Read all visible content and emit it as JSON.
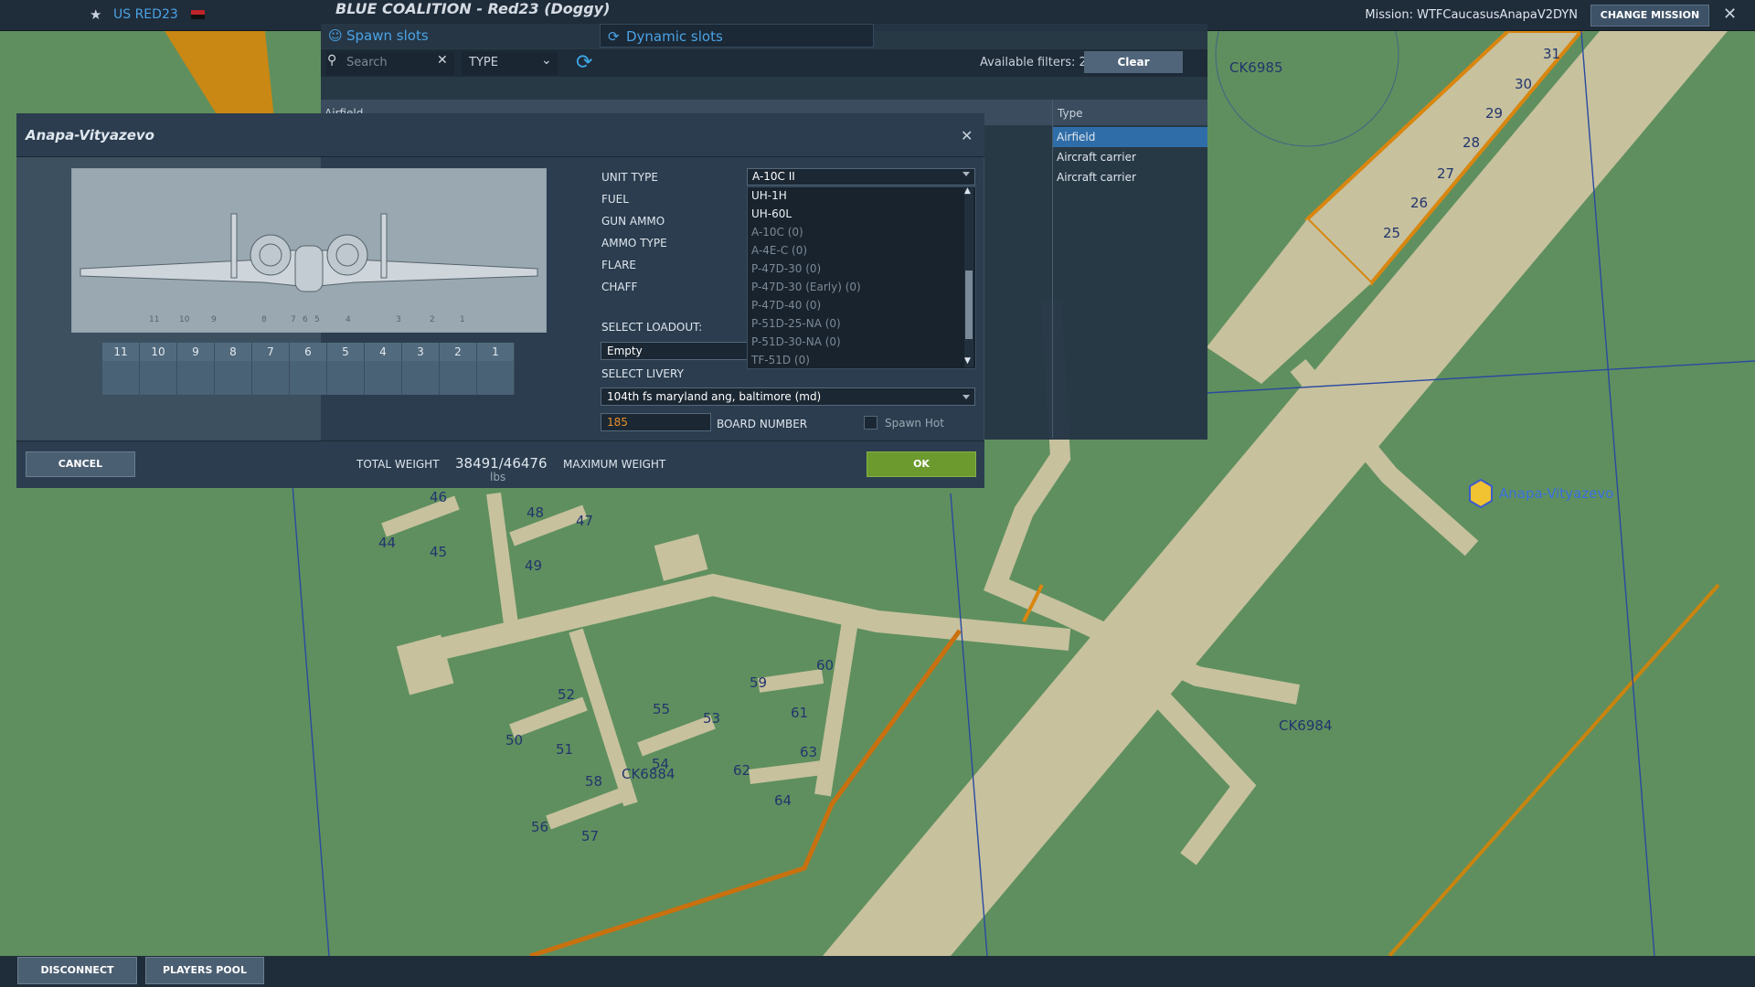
{
  "topbar": {
    "coalition_name": "US RED23",
    "title": "BLUE COALITION - Red23 (Doggy)",
    "mission": "Mission: WTFCaucasusAnapaV2DYN",
    "change_mission": "CHANGE MISSION",
    "close": "✕",
    "icons": [
      "briefing-icon",
      "players-icon",
      "star-icon",
      "flag-icon"
    ]
  },
  "slots_panel": {
    "tabs": [
      {
        "label": "Spawn slots",
        "icon": "players-icon"
      },
      {
        "label": "Dynamic slots",
        "icon": "dynamic-icon"
      }
    ],
    "search_placeholder": "Search",
    "type_filter": "TYPE",
    "available_filters": "Available filters: 2",
    "clear": "Clear",
    "columns": [
      "Airfield",
      "Type"
    ],
    "rows": [
      {
        "type": "Airfield",
        "selected": true
      },
      {
        "type": "Aircraft carrier",
        "selected": false
      },
      {
        "type": "Aircraft carrier",
        "selected": false
      }
    ]
  },
  "dialog": {
    "title": "Anapa-Vityazevo",
    "pylons": [
      "11",
      "10",
      "9",
      "8",
      "7",
      "6",
      "5",
      "4",
      "3",
      "2",
      "1"
    ],
    "labels": {
      "unit_type": "UNIT TYPE",
      "fuel": "FUEL",
      "gun_ammo": "GUN AMMO",
      "ammo_type": "AMMO TYPE",
      "flare": "FLARE",
      "chaff": "CHAFF",
      "select_loadout": "SELECT LOADOUT:",
      "select_livery": "SELECT LIVERY",
      "board_number": "BOARD NUMBER",
      "spawn_hot": "Spawn Hot",
      "total_weight": "TOTAL WEIGHT",
      "maximum_weight": "MAXIMUM WEIGHT"
    },
    "unit_type_value": "A-10C II",
    "dropdown_options": [
      {
        "label": "UH-1H",
        "enabled": true
      },
      {
        "label": "UH-60L",
        "enabled": true
      },
      {
        "label": "A-10C (0)",
        "enabled": false
      },
      {
        "label": "A-4E-C (0)",
        "enabled": false
      },
      {
        "label": "P-47D-30 (0)",
        "enabled": false
      },
      {
        "label": "P-47D-30 (Early) (0)",
        "enabled": false
      },
      {
        "label": "P-47D-40 (0)",
        "enabled": false
      },
      {
        "label": "P-51D-25-NA (0)",
        "enabled": false
      },
      {
        "label": "P-51D-30-NA (0)",
        "enabled": false
      },
      {
        "label": "TF-51D (0)",
        "enabled": false
      }
    ],
    "loadout_value": "Empty",
    "livery_value": "104th fs maryland ang, baltimore (md)",
    "board_number_value": "185",
    "spawn_hot": false,
    "total_weight_value": "38491/46476",
    "weight_unit": "lbs",
    "cancel": "CANCEL",
    "ok": "OK"
  },
  "map": {
    "labels": [
      "CK6985",
      "CK6984",
      "CK6884",
      "Anapa-Vityazevo"
    ],
    "runway_numbers": [
      "31",
      "30",
      "29",
      "28",
      "27",
      "26",
      "25"
    ],
    "parking_numbers": [
      "46",
      "47",
      "48",
      "44",
      "45",
      "49",
      "52",
      "50",
      "51",
      "55",
      "53",
      "54",
      "58",
      "56",
      "57",
      "59",
      "60",
      "61",
      "62",
      "63",
      "64"
    ]
  },
  "bottombar": {
    "disconnect": "DISCONNECT",
    "players_pool": "PLAYERS POOL"
  },
  "colors": {
    "accent": "#4aa3e6",
    "ok": "#6d9a2e",
    "board": "#e88f2a",
    "selected_row": "#2f6da8"
  }
}
